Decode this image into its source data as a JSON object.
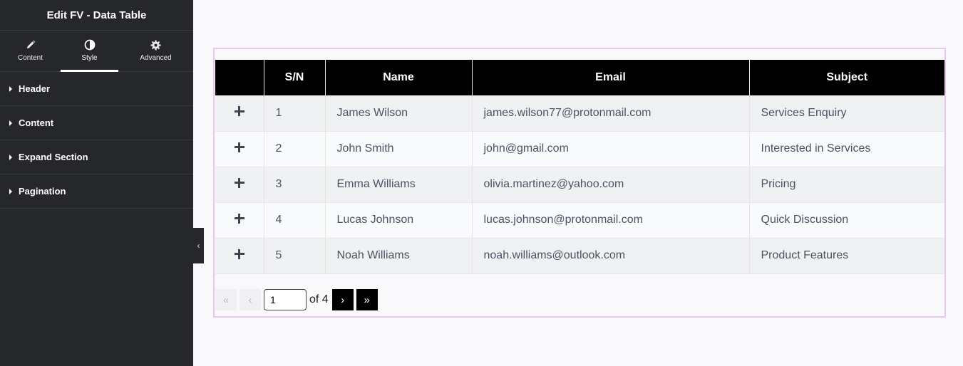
{
  "sidebar": {
    "title": "Edit FV - Data Table",
    "tabs": [
      {
        "label": "Content",
        "icon": "pencil-icon"
      },
      {
        "label": "Style",
        "icon": "half-circle-icon"
      },
      {
        "label": "Advanced",
        "icon": "gear-icon"
      }
    ],
    "active_tab": "Style",
    "sections": [
      "Header",
      "Content",
      "Expand Section",
      "Pagination"
    ],
    "collapse_glyph": "‹"
  },
  "table": {
    "columns": [
      "",
      "S/N",
      "Name",
      "Email",
      "Subject"
    ],
    "rows": [
      {
        "sn": "1",
        "name": "James Wilson",
        "email": "james.wilson77@protonmail.com",
        "subject": "Services Enquiry"
      },
      {
        "sn": "2",
        "name": "John Smith",
        "email": "john@gmail.com",
        "subject": "Interested in Services"
      },
      {
        "sn": "3",
        "name": "Emma Williams",
        "email": "olivia.martinez@yahoo.com",
        "subject": "Pricing"
      },
      {
        "sn": "4",
        "name": "Lucas Johnson",
        "email": "lucas.johnson@protonmail.com",
        "subject": "Quick Discussion"
      },
      {
        "sn": "5",
        "name": "Noah Williams",
        "email": "noah.williams@outlook.com",
        "subject": "Product Features"
      }
    ]
  },
  "pagination": {
    "first": "«",
    "prev": "‹",
    "current_page": "1",
    "of_text": "of 4",
    "next": "›",
    "last": "»"
  },
  "colors": {
    "sidebar_bg": "#26272b",
    "header_bg": "#000000",
    "widget_border": "#e7c8ea",
    "text": "#4b5263"
  }
}
